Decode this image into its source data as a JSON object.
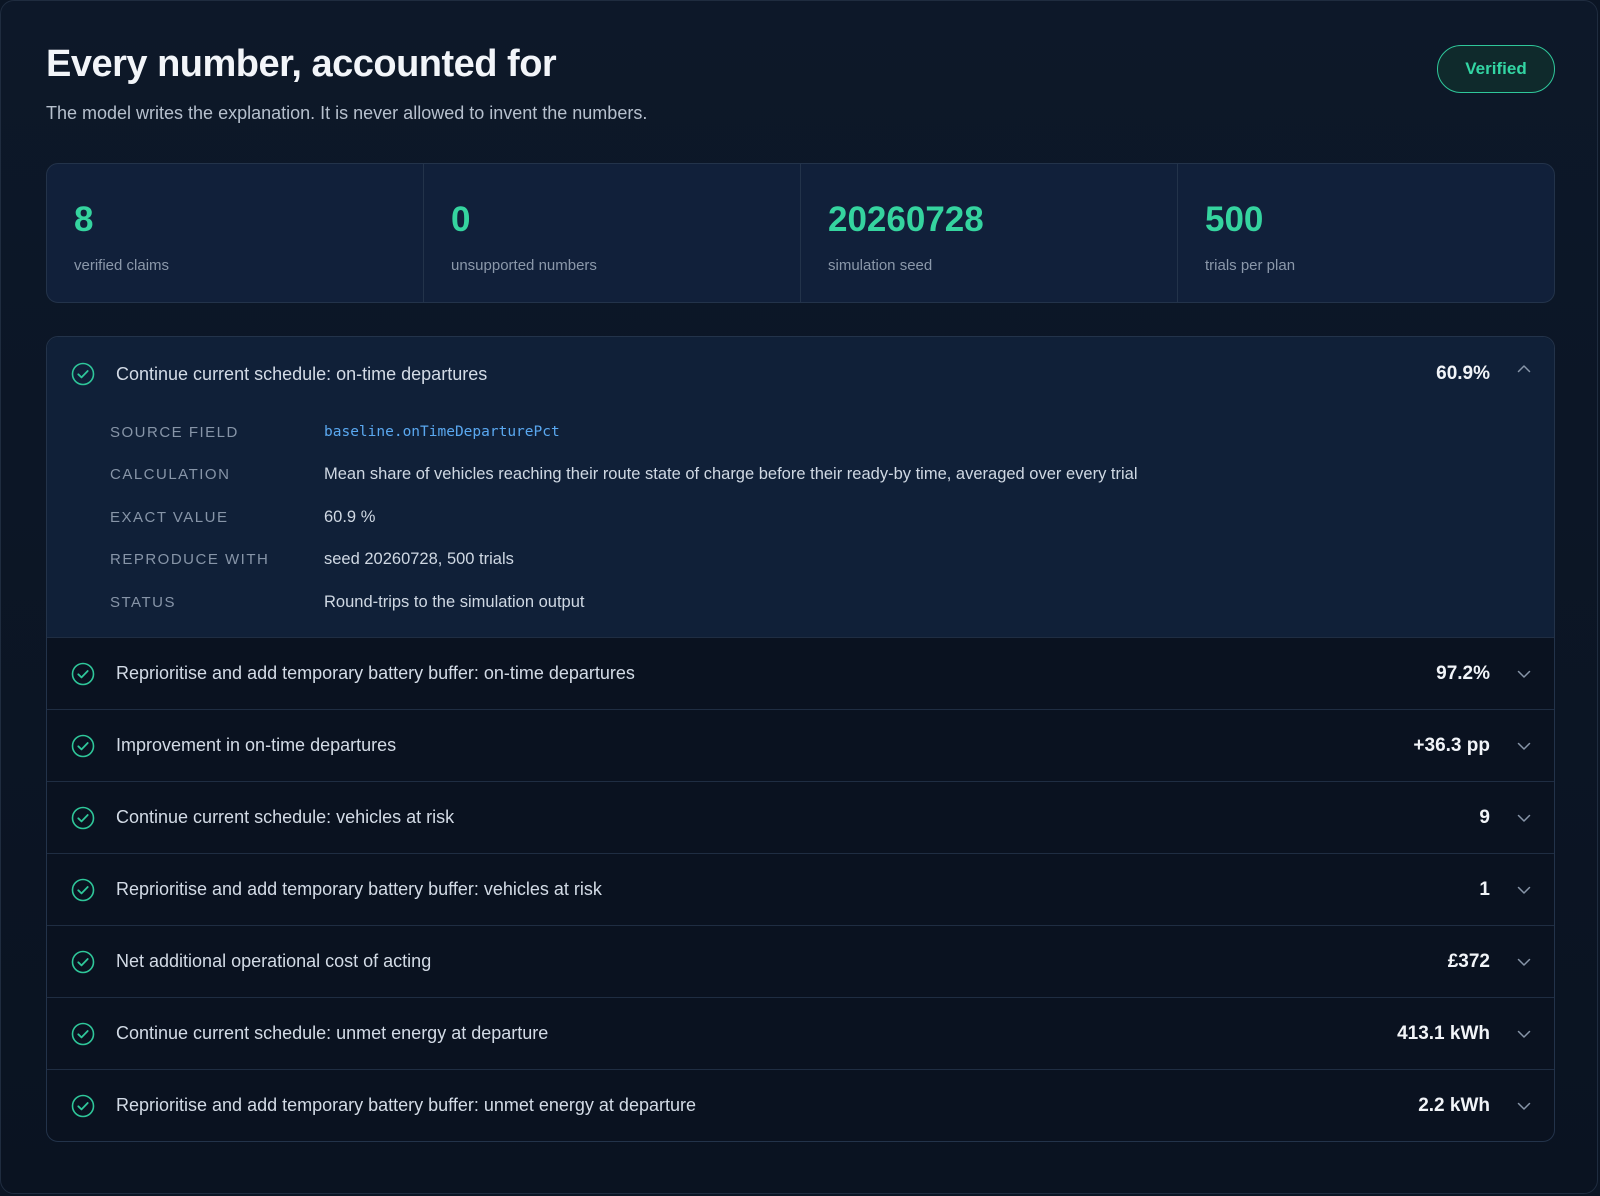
{
  "header": {
    "title": "Every number, accounted for",
    "subtitle": "The model writes the explanation. It is never allowed to invent the numbers.",
    "badge": "Verified"
  },
  "stats": [
    {
      "value": "8",
      "label": "verified claims"
    },
    {
      "value": "0",
      "label": "unsupported numbers"
    },
    {
      "value": "20260728",
      "label": "simulation seed"
    },
    {
      "value": "500",
      "label": "trials per plan"
    }
  ],
  "claims": [
    {
      "label": "Continue current schedule: on-time departures",
      "value": "60.9%",
      "expanded": true,
      "details": [
        {
          "key": "SOURCE FIELD",
          "value": "baseline.onTimeDeparturePct"
        },
        {
          "key": "CALCULATION",
          "value": "Mean share of vehicles reaching their route state of charge before their ready-by time, averaged over every trial"
        },
        {
          "key": "EXACT VALUE",
          "value": "60.9 %"
        },
        {
          "key": "REPRODUCE WITH",
          "value": "seed 20260728, 500 trials"
        },
        {
          "key": "STATUS",
          "value": "Round-trips to the simulation output"
        }
      ]
    },
    {
      "label": "Reprioritise and add temporary battery buffer: on-time departures",
      "value": "97.2%",
      "expanded": false
    },
    {
      "label": "Improvement in on-time departures",
      "value": "+36.3 pp",
      "expanded": false
    },
    {
      "label": "Continue current schedule: vehicles at risk",
      "value": "9",
      "expanded": false
    },
    {
      "label": "Reprioritise and add temporary battery buffer: vehicles at risk",
      "value": "1",
      "expanded": false
    },
    {
      "label": "Net additional operational cost of acting",
      "value": "£372",
      "expanded": false
    },
    {
      "label": "Continue current schedule: unmet energy at departure",
      "value": "413.1 kWh",
      "expanded": false
    },
    {
      "label": "Reprioritise and add temporary battery buffer: unmet energy at departure",
      "value": "2.2 kWh",
      "expanded": false
    }
  ],
  "colors": {
    "accent": "#35d49f",
    "background": "#0b1524",
    "code": "#5aa8f0"
  },
  "icons": {
    "claim_status": "check-circle-icon",
    "expand": "chevron-down-icon",
    "collapse": "chevron-up-icon"
  }
}
